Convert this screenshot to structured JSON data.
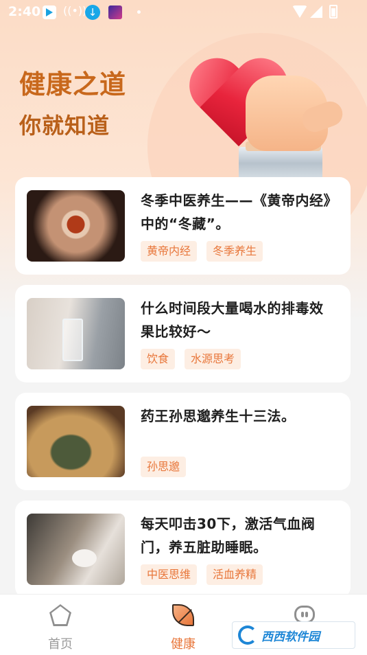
{
  "status_bar": {
    "time": "2:40",
    "icons": [
      "app-icon",
      "sound-wave-icon",
      "download-icon",
      "app-icon",
      "dot-icon",
      "wifi-icon",
      "signal-icon",
      "battery-icon"
    ]
  },
  "hero": {
    "title": "健康之道",
    "subtitle": "你就知道"
  },
  "cards": [
    {
      "title": "冬季中医养生——《黄帝内经》中的“冬藏”。",
      "image": "tea-cup-photo",
      "tags": [
        "黄帝内经",
        "冬季养生"
      ]
    },
    {
      "title": "什么时间段大量喝水的排毒效果比较好～",
      "image": "water-glass-photo",
      "tags": [
        "饮食",
        "水源思考"
      ]
    },
    {
      "title": "药王孙思邈养生十三法。",
      "image": "herbs-basket-photo",
      "tags": [
        "孙思邈"
      ]
    },
    {
      "title": "每天叩击30下，激活气血阀门，养五脏助睡眠。",
      "image": "piggy-bank-photo",
      "tags": [
        "中医思维",
        "活血养精"
      ]
    }
  ],
  "bottom_nav": {
    "items": [
      {
        "label": "首页",
        "icon": "pentagon-home-icon",
        "active": false
      },
      {
        "label": "健康",
        "icon": "leaf-icon",
        "active": true
      },
      {
        "label": "",
        "icon": "robot-profile-icon",
        "active": false
      }
    ],
    "active_color": "#e8763a",
    "inactive_color": "#9a9a9a"
  },
  "watermark": {
    "text": "西西软件园"
  },
  "colors": {
    "accent": "#e8763a",
    "title": "#c8681c",
    "tag_bg": "#fdeee3"
  }
}
